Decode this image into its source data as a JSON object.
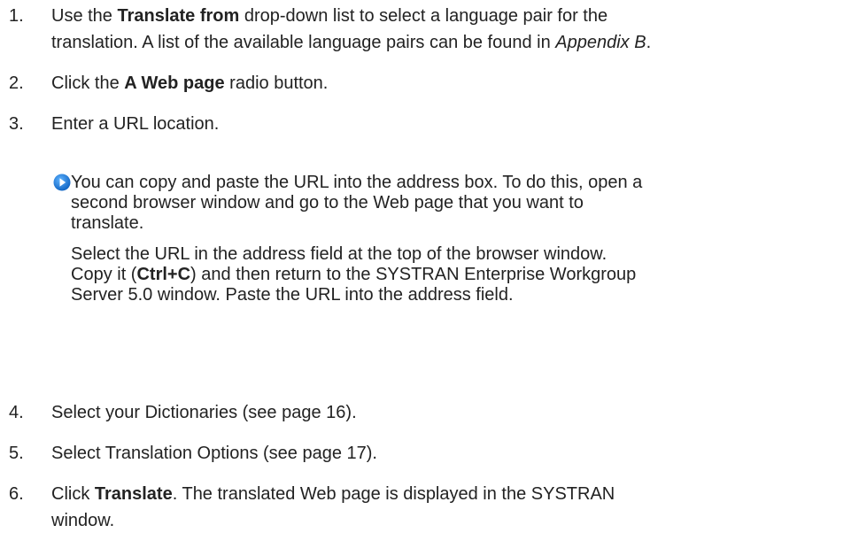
{
  "steps": [
    {
      "number": "1.",
      "line1_pre": "Use the ",
      "line1_bold": "Translate from",
      "line1_post": " drop-down list to select a language pair for the",
      "line2_pre": "translation. A list of the available language pairs can be found in ",
      "line2_italic": "Appendix B",
      "line2_post": "."
    },
    {
      "number": "2.",
      "pre": "Click the ",
      "bold": "A Web page",
      "post": " radio button."
    },
    {
      "number": "3.",
      "text": "Enter a URL location."
    },
    {
      "number": "4.",
      "text": "Select your Dictionaries (see page 16)."
    },
    {
      "number": "5.",
      "text": "Select Translation Options (see page 17)."
    },
    {
      "number": "6.",
      "pre": "Click ",
      "bold": "Translate",
      "post": ". The translated Web page is displayed in the SYSTRAN",
      "line2": "window."
    }
  ],
  "note": {
    "icon": "arrow-right-circle-icon",
    "icon_color": "#1e7fd6",
    "para1_line1": "You can copy and paste the URL into the address box. To do this, open a",
    "para1_line2": "second browser window and go to the Web page that you want to",
    "para1_line3": "translate.",
    "para2_line1": "Select the URL in the address field at the top of the browser window.",
    "para2_line2_pre": "Copy it (",
    "para2_line2_bold": "Ctrl+C",
    "para2_line2_post": ") and then return to the SYSTRAN Enterprise Workgroup",
    "para2_line3": "Server 5.0 window. Paste the URL into the address field."
  }
}
